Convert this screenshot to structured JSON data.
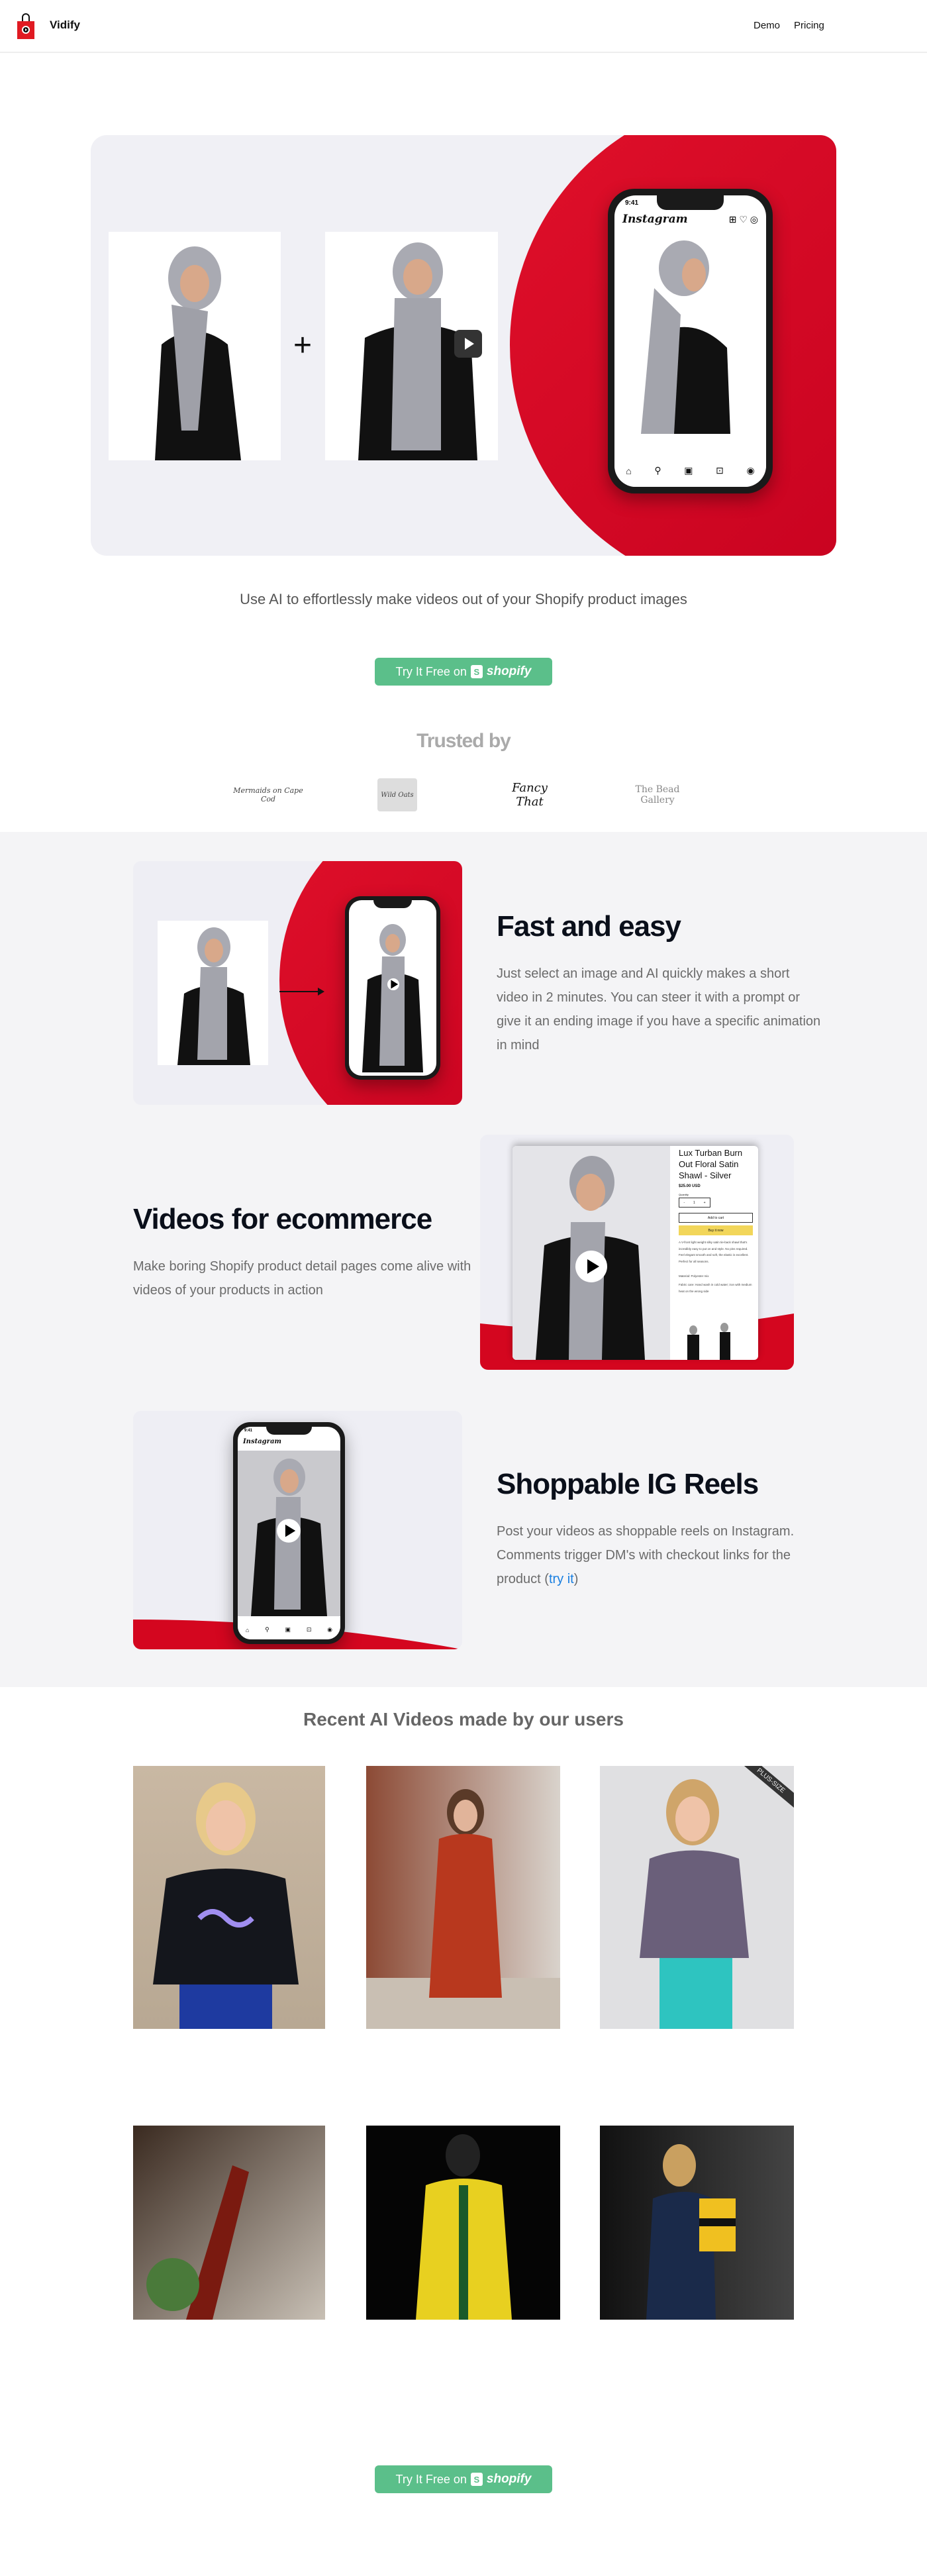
{
  "nav": {
    "brand": "Vidify",
    "links": [
      "Demo",
      "Pricing"
    ]
  },
  "hero": {
    "plus": "+",
    "phone": {
      "time": "9:41",
      "app": "Instagram"
    },
    "subtitle": "Use AI to effortlessly make videos out of your Shopify product images",
    "cta": {
      "label": "Try It Free on",
      "brand": "shopify"
    }
  },
  "trusted": {
    "title": "Trusted by",
    "logos": [
      "Mermaids on Cape Cod",
      "Wild Oats",
      "Fancy That",
      "The Bead Gallery"
    ]
  },
  "features": [
    {
      "title": "Fast and easy",
      "text": "Just select an image and AI quickly makes a short video in 2 minutes. You can steer it with a prompt or give it an ending image if you have a specific animation in mind"
    },
    {
      "title": "Videos for ecommerce",
      "text": "Make boring Shopify product detail pages come alive with videos of your products in action",
      "product": {
        "name": "Lux Turban Burn Out Floral Satin Shawl - Silver",
        "price": "$25.00 USD",
        "quantity_label": "Quantity",
        "quantity": "1",
        "add_to_cart": "Add to cart",
        "buy_now": "Buy it now",
        "description": "A V-front light weight silky satin tie-back shawl that's incredibly easy to put on and style. No pins required. Feel elegant smooth and soft, the elastic is excellent. Perfect for all seasons.",
        "material": "Material: Polyester mix",
        "care": "Fabric care: Hand wash in cold water; iron with medium heat on the wrong side"
      }
    },
    {
      "title": "Shoppable IG Reels",
      "text": "Post your videos as shoppable reels on Instagram. Comments trigger DM's with checkout links for the product (",
      "link": "try it",
      "after": ")"
    }
  ],
  "recent": {
    "title": "Recent AI Videos made by our users",
    "ribbon": "PLUS-SIZE"
  },
  "colors": {
    "accent_red": "#d4061f",
    "cta_green": "#5bbf8a",
    "link_blue": "#1a7fe0"
  }
}
